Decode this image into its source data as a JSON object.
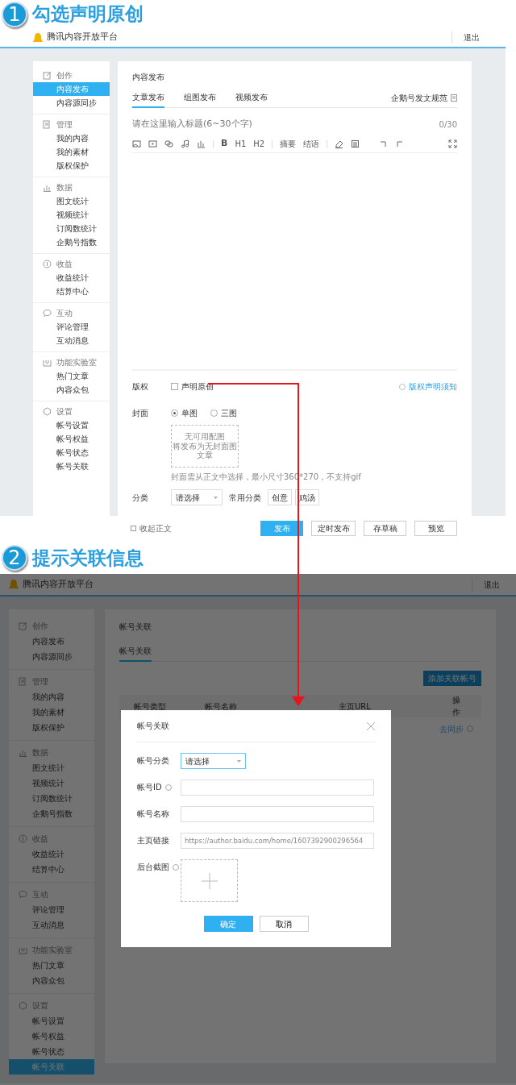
{
  "step1": {
    "number": "1",
    "title": "勾选声明原创"
  },
  "app1": {
    "brand": "腾讯内容开放平台",
    "logout": "退出",
    "sidebar": [
      {
        "label": "创作",
        "items": [
          {
            "label": "内容发布",
            "selected": true
          },
          {
            "label": "内容源同步",
            "selected": false
          }
        ]
      },
      {
        "label": "管理",
        "items": [
          {
            "label": "我的内容",
            "selected": false
          },
          {
            "label": "我的素材",
            "selected": false
          },
          {
            "label": "版权保护",
            "selected": false
          }
        ]
      },
      {
        "label": "数据",
        "items": [
          {
            "label": "图文统计",
            "selected": false
          },
          {
            "label": "视频统计",
            "selected": false
          },
          {
            "label": "订阅数统计",
            "selected": false
          },
          {
            "label": "企鹅号指数",
            "selected": false
          }
        ]
      },
      {
        "label": "收益",
        "items": [
          {
            "label": "收益统计",
            "selected": false
          },
          {
            "label": "结算中心",
            "selected": false
          }
        ]
      },
      {
        "label": "互动",
        "items": [
          {
            "label": "评论管理",
            "selected": false
          },
          {
            "label": "互动消息",
            "selected": false
          }
        ]
      },
      {
        "label": "功能实验室",
        "items": [
          {
            "label": "热门文章",
            "selected": false
          },
          {
            "label": "内容众包",
            "selected": false
          }
        ]
      },
      {
        "label": "设置",
        "items": [
          {
            "label": "帐号设置",
            "selected": false
          },
          {
            "label": "帐号权益",
            "selected": false
          },
          {
            "label": "帐号状态",
            "selected": false
          },
          {
            "label": "帐号关联",
            "selected": false
          }
        ]
      }
    ],
    "page_title": "内容发布",
    "tabs": [
      {
        "label": "文章发布",
        "selected": true
      },
      {
        "label": "组图发布",
        "selected": false
      },
      {
        "label": "视频发布",
        "selected": false
      }
    ],
    "guide_link": "企鹅号发文规范",
    "title_placeholder": "请在这里输入标题(6~30个字)",
    "title_count": "0/30",
    "toolbar_labels": [
      "B",
      "H1",
      "H2",
      "摘要",
      "结语"
    ],
    "copyright": {
      "label": "版权",
      "checkbox": {
        "label": "声明原创",
        "checked": false
      },
      "notice_link": "版权声明须知"
    },
    "cover": {
      "label": "封面",
      "options": [
        {
          "label": "单图",
          "selected": true
        },
        {
          "label": "三图",
          "selected": false
        }
      ],
      "empty_lines": [
        "无可用配图",
        "将发布为无封面图文章"
      ],
      "hint": "封面需从正文中选择，最小尺寸360*270，不支持gif"
    },
    "category": {
      "label": "分类",
      "placeholder": "请选择",
      "common_label": "常用分类",
      "tags": [
        "创意",
        "鸡汤"
      ]
    },
    "collapse": "收起正文",
    "actions": [
      {
        "label": "发布",
        "primary": true
      },
      {
        "label": "定时发布",
        "primary": false
      },
      {
        "label": "存草稿",
        "primary": false
      },
      {
        "label": "预览",
        "primary": false
      }
    ]
  },
  "step2": {
    "number": "2",
    "title": "提示关联信息"
  },
  "app2": {
    "brand": "腾讯内容开放平台",
    "logout": "退出",
    "sidebar": [
      {
        "label": "创作",
        "items": [
          {
            "label": "内容发布",
            "selected": false
          },
          {
            "label": "内容源同步",
            "selected": false
          }
        ]
      },
      {
        "label": "管理",
        "items": [
          {
            "label": "我的内容",
            "selected": false
          },
          {
            "label": "我的素材",
            "selected": false
          },
          {
            "label": "版权保护",
            "selected": false
          }
        ]
      },
      {
        "label": "数据",
        "items": [
          {
            "label": "图文统计",
            "selected": false
          },
          {
            "label": "视频统计",
            "selected": false
          },
          {
            "label": "订阅数统计",
            "selected": false
          },
          {
            "label": "企鹅号指数",
            "selected": false
          }
        ]
      },
      {
        "label": "收益",
        "items": [
          {
            "label": "收益统计",
            "selected": false
          },
          {
            "label": "结算中心",
            "selected": false
          }
        ]
      },
      {
        "label": "互动",
        "items": [
          {
            "label": "评论管理",
            "selected": false
          },
          {
            "label": "互动消息",
            "selected": false
          }
        ]
      },
      {
        "label": "功能实验室",
        "items": [
          {
            "label": "热门文章",
            "selected": false
          },
          {
            "label": "内容众包",
            "selected": false
          }
        ]
      },
      {
        "label": "设置",
        "items": [
          {
            "label": "帐号设置",
            "selected": false
          },
          {
            "label": "帐号权益",
            "selected": false
          },
          {
            "label": "帐号状态",
            "selected": false
          },
          {
            "label": "帐号关联",
            "selected": true
          }
        ]
      }
    ],
    "page_title": "帐号关联",
    "tabs": [
      {
        "label": "帐号关联",
        "selected": true
      }
    ],
    "add_button": "添加关联帐号",
    "table": {
      "columns": [
        "帐号类型",
        "帐号名称",
        "主页URL",
        "操作"
      ],
      "row_action": "去同步"
    },
    "modal": {
      "title": "帐号关联",
      "fields": [
        {
          "kind": "select",
          "label": "帐号分类",
          "placeholder": "请选择",
          "help": false
        },
        {
          "kind": "text",
          "label": "帐号ID",
          "help": true
        },
        {
          "kind": "text",
          "label": "帐号名称",
          "help": false
        },
        {
          "kind": "text",
          "label": "主页链接",
          "placeholder": "https://author.baidu.com/home/1607392900296564",
          "help": false
        },
        {
          "kind": "upload",
          "label": "后台截图",
          "help": true
        }
      ],
      "buttons": [
        {
          "label": "确定",
          "primary": true
        },
        {
          "label": "取消",
          "primary": false
        }
      ]
    }
  }
}
